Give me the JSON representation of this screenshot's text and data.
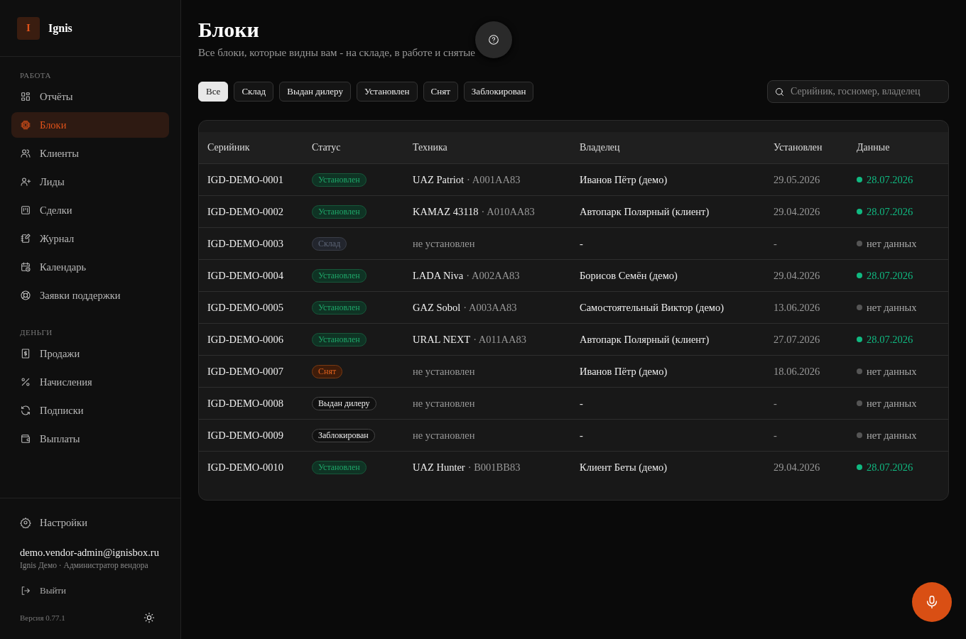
{
  "brand": {
    "letter": "I",
    "name": "Ignis"
  },
  "sidebar": {
    "sections": [
      {
        "title": "РАБОТА",
        "items": [
          {
            "label": "Отчёты",
            "selected": false
          },
          {
            "label": "Блоки",
            "selected": true
          },
          {
            "label": "Клиенты",
            "selected": false
          },
          {
            "label": "Лиды",
            "selected": false
          },
          {
            "label": "Сделки",
            "selected": false
          },
          {
            "label": "Журнал",
            "selected": false
          },
          {
            "label": "Календарь",
            "selected": false
          },
          {
            "label": "Заявки поддержки",
            "selected": false
          }
        ]
      },
      {
        "title": "ДЕНЬГИ",
        "items": [
          {
            "label": "Продажи",
            "selected": false
          },
          {
            "label": "Начисления",
            "selected": false
          },
          {
            "label": "Подписки",
            "selected": false
          },
          {
            "label": "Выплаты",
            "selected": false
          }
        ]
      }
    ],
    "settings": "Настройки",
    "user": {
      "email": "demo.vendor-admin@ignisbox.ru",
      "role": "Ignis Демо · Администратор вендора"
    },
    "logout": "Выйти",
    "version": "Версия 0.77.1"
  },
  "page": {
    "title": "Блоки",
    "subtitle": "Все блоки, которые видны вам - на складе, в работе и снятые"
  },
  "filters": [
    {
      "label": "Все",
      "selected": true
    },
    {
      "label": "Склад",
      "selected": false
    },
    {
      "label": "Выдан дилеру",
      "selected": false
    },
    {
      "label": "Установлен",
      "selected": false
    },
    {
      "label": "Снят",
      "selected": false
    },
    {
      "label": "Заблокирован",
      "selected": false
    }
  ],
  "search": {
    "placeholder": "Серийник, госномер, владелец"
  },
  "table": {
    "columns": [
      "Серийник",
      "Статус",
      "Техника",
      "Владелец",
      "Установлен",
      "Данные"
    ],
    "rows": [
      {
        "serial": "IGD-DEMO-0001",
        "status": {
          "label": "Установлен",
          "kind": "installed"
        },
        "vehicle": {
          "model": "UAZ Patriot",
          "plate": "· A001AA83"
        },
        "owner": "Иванов Пётр (демо)",
        "installed": "29.05.2026",
        "data": {
          "text": "28.07.2026",
          "color": "#10b981"
        }
      },
      {
        "serial": "IGD-DEMO-0002",
        "status": {
          "label": "Установлен",
          "kind": "installed"
        },
        "vehicle": {
          "model": "KAMAZ 43118",
          "plate": "· A010AA83"
        },
        "owner": "Автопарк Полярный (клиент)",
        "installed": "29.04.2026",
        "data": {
          "text": "28.07.2026",
          "color": "#10b981"
        }
      },
      {
        "serial": "IGD-DEMO-0003",
        "status": {
          "label": "Склад",
          "kind": "warehouse"
        },
        "vehicle": {
          "none": "не установлен"
        },
        "owner": "-",
        "installed": "-",
        "data": {
          "text": "нет данных",
          "color": "#555555"
        }
      },
      {
        "serial": "IGD-DEMO-0004",
        "status": {
          "label": "Установлен",
          "kind": "installed"
        },
        "vehicle": {
          "model": "LADA Niva",
          "plate": "· A002AA83"
        },
        "owner": "Борисов Семён (демо)",
        "installed": "29.04.2026",
        "data": {
          "text": "28.07.2026",
          "color": "#10b981"
        }
      },
      {
        "serial": "IGD-DEMO-0005",
        "status": {
          "label": "Установлен",
          "kind": "installed"
        },
        "vehicle": {
          "model": "GAZ Sobol",
          "plate": "· A003AA83"
        },
        "owner": "Самостоятельный Виктор (демо)",
        "installed": "13.06.2026",
        "data": {
          "text": "нет данных",
          "color": "#555555"
        }
      },
      {
        "serial": "IGD-DEMO-0006",
        "status": {
          "label": "Установлен",
          "kind": "installed"
        },
        "vehicle": {
          "model": "URAL NEXT",
          "plate": "· A011AA83"
        },
        "owner": "Автопарк Полярный (клиент)",
        "installed": "27.07.2026",
        "data": {
          "text": "28.07.2026",
          "color": "#10b981"
        }
      },
      {
        "serial": "IGD-DEMO-0007",
        "status": {
          "label": "Снят",
          "kind": "removed"
        },
        "vehicle": {
          "none": "не установлен"
        },
        "owner": "Иванов Пётр (демо)",
        "installed": "18.06.2026",
        "data": {
          "text": "нет данных",
          "color": "#555555"
        }
      },
      {
        "serial": "IGD-DEMO-0008",
        "status": {
          "label": "Выдан дилеру",
          "kind": "dealer"
        },
        "vehicle": {
          "none": "не установлен"
        },
        "owner": "-",
        "installed": "-",
        "data": {
          "text": "нет данных",
          "color": "#555555"
        }
      },
      {
        "serial": "IGD-DEMO-0009",
        "status": {
          "label": "Заблокирован",
          "kind": "blocked"
        },
        "vehicle": {
          "none": "не установлен"
        },
        "owner": "-",
        "installed": "-",
        "data": {
          "text": "нет данных",
          "color": "#555555"
        }
      },
      {
        "serial": "IGD-DEMO-0010",
        "status": {
          "label": "Установлен",
          "kind": "installed"
        },
        "vehicle": {
          "model": "UAZ Hunter",
          "plate": "· B001BB83"
        },
        "owner": "Клиент Беты (демо)",
        "installed": "29.04.2026",
        "data": {
          "text": "28.07.2026",
          "color": "#10b981"
        }
      }
    ]
  }
}
